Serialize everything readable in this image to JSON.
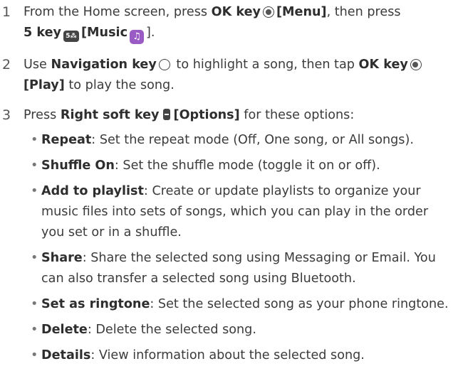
{
  "steps": [
    {
      "number": "1",
      "line1": {
        "pre": "From the Home screen, press ",
        "key": "OK key",
        "bracket": "[Menu]",
        "post": ", then press"
      },
      "line2": {
        "key": "5 key",
        "icon5": "5⁂",
        "bracket": "[Music",
        "end": "]."
      }
    },
    {
      "number": "2",
      "line1": {
        "pre": "Use ",
        "key": "Navigation key",
        "mid": " to highlight a song, then tap ",
        "key2": "OK key"
      },
      "line2": {
        "bracket": "[Play]",
        "post": " to play the song."
      }
    },
    {
      "number": "3",
      "line1": {
        "pre": "Press ",
        "key": "Right soft key",
        "bracket": "[Options]",
        "post": " for these options:"
      }
    }
  ],
  "options": [
    {
      "term": "Repeat",
      "desc": ": Set the repeat mode (Off, One song, or All songs)."
    },
    {
      "term": "Shuffle On",
      "desc": ": Set the shuffle mode (toggle it on or off)."
    },
    {
      "term": "Add to playlist",
      "desc": ": Create or update playlists to organize your music files into sets of songs, which you can play in the order you set or in a shuffle."
    },
    {
      "term": "Share",
      "desc": ": Share the selected song using Messaging or Email. You can also transfer a selected song using Bluetooth."
    },
    {
      "term": "Set as ringtone",
      "desc": ": Set the selected song as your phone ringtone."
    },
    {
      "term": "Delete",
      "desc": ": Delete the selected song."
    },
    {
      "term": "Details",
      "desc": ": View information about the selected song."
    }
  ],
  "bullet_char": "•",
  "icons": {
    "ok": "ok-key-icon",
    "five": "five-key-icon",
    "music": "music-app-icon",
    "nav": "navigation-key-icon",
    "soft": "right-soft-key-icon"
  },
  "colors": {
    "music_icon": "#9a5cc4",
    "text": "#3b3b3b"
  }
}
